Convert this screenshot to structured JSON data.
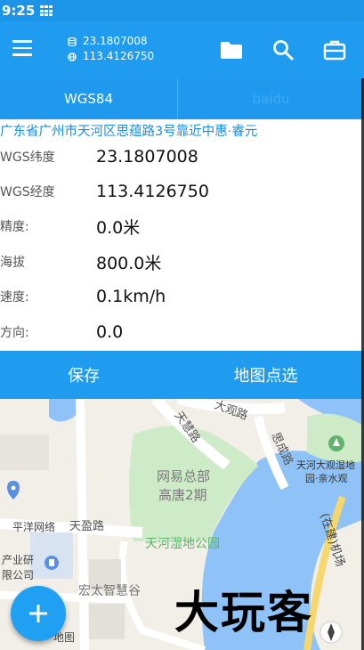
{
  "status_bar": {
    "time": "9:25"
  },
  "app_bar": {
    "latitude": "23.1807008",
    "longitude": "113.4126750",
    "icons": [
      "menu-icon",
      "folder-icon",
      "search-icon",
      "briefcase-icon"
    ]
  },
  "tabs": [
    {
      "label": "WGS84",
      "active": true
    },
    {
      "label": "baidu",
      "active": false
    }
  ],
  "address": "广东省广州市天河区思蕴路3号靠近中惠·睿元",
  "info": {
    "lat_label": "WGS纬度",
    "lat_value": "23.1807008",
    "lng_label": "WGS经度",
    "lng_value": "113.4126750",
    "accuracy_label": "精度:",
    "accuracy_value": "0.0米",
    "altitude_label": "海拔",
    "altitude_value": "800.0米",
    "speed_label": "速度:",
    "speed_value": "0.1km/h",
    "direction_label": "方向:",
    "direction_value": "0.0"
  },
  "actions": {
    "save": "保存",
    "map_pick": "地图点选"
  },
  "map": {
    "labels": {
      "tianhui_road": "天慧路",
      "dagu_road": "大观路",
      "wangyi": "网易总部",
      "gaotang": "高唐2期",
      "sicheng_road": "思成路",
      "tianhe_park_right": "天河大观湿地",
      "park_yuan": "园·亲水观",
      "pingyang": "平洋网络",
      "tianying_road": "天盈路",
      "industry": "产业研",
      "company": "限公司",
      "tianhe_wetland": "天河湿地公园",
      "hongtai": "宏太智慧谷",
      "map_word": "地图",
      "construction": "(在建)机场"
    }
  },
  "fab": {
    "label": "+"
  },
  "watermark": "大玩客",
  "colors": {
    "primary": "#1f9cf0",
    "address": "#1b8ee0",
    "water": "#8fc3f7",
    "park": "#cdebc6"
  }
}
